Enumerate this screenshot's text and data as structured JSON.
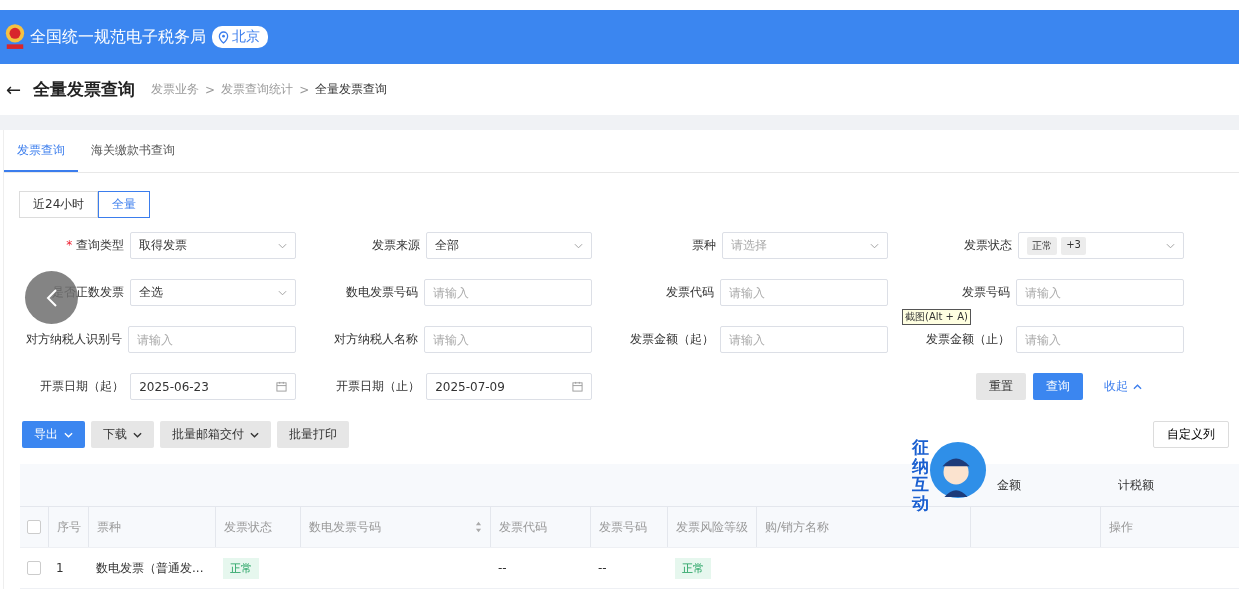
{
  "header": {
    "title": "全国统一规范电子税务局",
    "location": "北京"
  },
  "page": {
    "back": "←",
    "title": "全量发票查询",
    "breadcrumb": [
      {
        "label": "发票业务",
        "current": false
      },
      {
        "label": "发票查询统计",
        "current": false
      },
      {
        "label": "全量发票查询",
        "current": true
      }
    ],
    "separator": ">"
  },
  "tabs": [
    {
      "label": "发票查询",
      "selected": true
    },
    {
      "label": "海关缴款书查询",
      "selected": false
    }
  ],
  "range": [
    {
      "label": "近24小时",
      "selected": false
    },
    {
      "label": "全量",
      "selected": true
    }
  ],
  "filters": [
    {
      "label": "查询类型",
      "required_mark": "*",
      "kind": "select",
      "value": "取得发票"
    },
    {
      "label": "发票来源",
      "kind": "select",
      "value": "全部"
    },
    {
      "label": "票种",
      "kind": "select",
      "placeholder": "请选择"
    },
    {
      "label": "发票状态",
      "kind": "tags",
      "tags": [
        "正常",
        "+3"
      ]
    },
    {
      "label": "是否正数发票",
      "kind": "select",
      "value": "全选"
    },
    {
      "label": "数电发票号码",
      "kind": "input",
      "placeholder": "请输入"
    },
    {
      "label": "发票代码",
      "kind": "input",
      "placeholder": "请输入"
    },
    {
      "label": "发票号码",
      "kind": "input",
      "placeholder": "请输入"
    },
    {
      "label": "对方纳税人识别号",
      "kind": "input",
      "placeholder": "请输入"
    },
    {
      "label": "对方纳税人名称",
      "kind": "input",
      "placeholder": "请输入"
    },
    {
      "label": "发票金额（起）",
      "kind": "input",
      "placeholder": "请输入"
    },
    {
      "label": "发票金额（止）",
      "kind": "input",
      "placeholder": "请输入"
    },
    {
      "label": "开票日期（起）",
      "kind": "date",
      "value": "2025-06-23"
    },
    {
      "label": "开票日期（止）",
      "kind": "date",
      "value": "2025-07-09"
    }
  ],
  "form_actions": {
    "reset": "重置",
    "search": "查询",
    "collapse": "收起"
  },
  "tooltip": "截图(Alt + A)",
  "toolbar": [
    {
      "label": "导出",
      "primary": true,
      "dropdown": true
    },
    {
      "label": "下载",
      "primary": false,
      "dropdown": true
    },
    {
      "label": "批量邮箱交付",
      "primary": false,
      "dropdown": true
    },
    {
      "label": "批量打印",
      "primary": false,
      "dropdown": false
    }
  ],
  "customize_columns": "自定义列",
  "table": {
    "summary": [
      "金额",
      "计税额"
    ],
    "columns": [
      {
        "label": "序号",
        "kind": "plain"
      },
      {
        "label": "票种",
        "kind": "plain"
      },
      {
        "label": "发票状态",
        "kind": "plain"
      },
      {
        "label": "数电发票号码",
        "kind": "sortable"
      },
      {
        "label": "发票代码",
        "kind": "plain"
      },
      {
        "label": "发票号码",
        "kind": "plain"
      },
      {
        "label": "发票风险等级",
        "kind": "plain"
      },
      {
        "label": "购/销方名称",
        "kind": "plain"
      },
      {
        "kind": "plain"
      },
      {
        "label": "操作",
        "kind": "plain"
      }
    ],
    "header_checked": false,
    "rows": [
      {
        "checked": false,
        "cells": [
          {
            "kind": "text",
            "text": "1"
          },
          {
            "kind": "text",
            "text": "数电发票（普通发..."
          },
          {
            "kind": "tag",
            "text": "正常"
          },
          {
            "kind": "blank"
          },
          {
            "kind": "text",
            "text": "--"
          },
          {
            "kind": "text",
            "text": "--"
          },
          {
            "kind": "tag",
            "text": "正常"
          },
          {
            "kind": "blank"
          },
          {
            "kind": "blank"
          },
          {
            "kind": "blank"
          }
        ]
      }
    ]
  },
  "assistant": {
    "label": "征纳互动"
  }
}
